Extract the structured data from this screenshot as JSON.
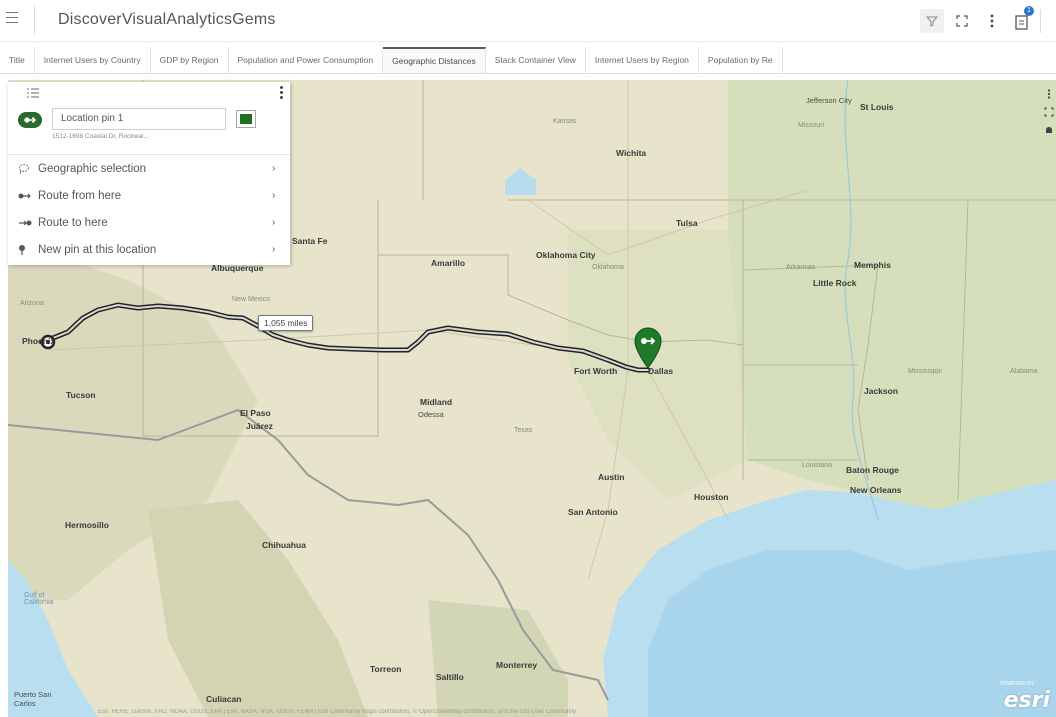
{
  "app": {
    "title": "DiscoverVisualAnalyticsGems",
    "notification_count": "1"
  },
  "header_icons": [
    "hamburger-icon",
    "filter-icon",
    "expand-icon",
    "more-vert-icon",
    "notes-icon"
  ],
  "tabs": [
    {
      "label": "Title",
      "active": false
    },
    {
      "label": "Internet Users by Country",
      "active": false
    },
    {
      "label": "GDP by Region",
      "active": false
    },
    {
      "label": "Population and Power Consumption",
      "active": false
    },
    {
      "label": "Geographic Distances",
      "active": true
    },
    {
      "label": "Stack Container View",
      "active": false
    },
    {
      "label": "Internet Users by Region",
      "active": false
    },
    {
      "label": "Population by Re",
      "active": false
    }
  ],
  "panel": {
    "pin_name": "Location pin 1",
    "pin_address": "1512-1698 Coastal Dr, Rockwal...",
    "pin_color": "#1e6e24",
    "menu": [
      {
        "label": "Geographic selection",
        "icon": "lasso-icon"
      },
      {
        "label": "Route from here",
        "icon": "route-from-icon"
      },
      {
        "label": "Route to here",
        "icon": "route-to-icon"
      },
      {
        "label": "New pin at this location",
        "icon": "map-pin-icon"
      }
    ]
  },
  "map": {
    "route_distance": "1,055 miles",
    "attribution": "Esri, HERE, Garmin, FAO, NOAA, USGS, EPA | Esri, NASA, NGA, USGS, FEMA | Esri Community Maps contributors, © OpenStreetMap contributors, and the GIS User Community",
    "esri_tagline": "POWERED BY",
    "logo": "esri",
    "labels": {
      "jefferson_city": "Jefferson City",
      "st_louis": "St Louis",
      "missouri": "Missouri",
      "kansas": "Kansas",
      "wichita": "Wichita",
      "tulsa": "Tulsa",
      "oklahoma_city": "Oklahoma City",
      "oklahoma": "Oklahoma",
      "amarillo": "Amarillo",
      "albuquerque": "Albuquerque",
      "santa_fe": "Santa Fe",
      "new_mexico": "New Mexico",
      "arkansas": "Arkansas",
      "memphis": "Memphis",
      "little_rock": "Little Rock",
      "arizona": "Arizona",
      "phoenix": "Phoenix",
      "tucson": "Tucson",
      "el_paso": "El Paso",
      "juarez": "Juárez",
      "midland": "Midland",
      "odessa": "Odessa",
      "texas": "Texas",
      "fort_worth": "Fort Worth",
      "dallas": "Dallas",
      "mississippi": "Mississippi",
      "alabama": "Alabama",
      "jackson": "Jackson",
      "louisiana": "Louisiana",
      "baton_rouge": "Baton Rouge",
      "new_orleans": "New Orleans",
      "austin": "Austin",
      "houston": "Houston",
      "san_antonio": "San Antonio",
      "hermosillo": "Hermosillo",
      "chihuahua": "Chihuahua",
      "gulf_of_california": "Gulf of California",
      "torreon": "Torreon",
      "saltillo": "Saltillo",
      "monterrey": "Monterrey",
      "culiacan": "Culiacan",
      "puerto_san_carlos": "Puerto San Carlos"
    }
  }
}
